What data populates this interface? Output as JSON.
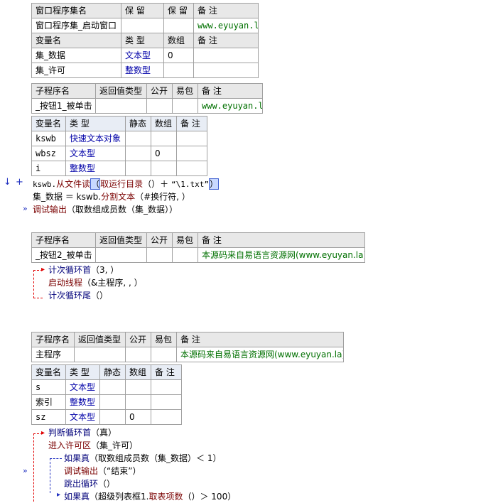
{
  "window_table": {
    "headers": [
      "窗口程序集名",
      "保 留",
      "保 留",
      "备 注"
    ],
    "row": [
      "窗口程序集_启动窗口",
      "",
      "",
      "www.eyuyan.la"
    ],
    "var_headers": [
      "变量名",
      "类 型",
      "数组",
      "备 注"
    ],
    "vars": [
      {
        "name": "集_数据",
        "type": "文本型",
        "array": "0",
        "note": ""
      },
      {
        "name": "集_许可",
        "type": "整数型",
        "array": "",
        "note": ""
      }
    ]
  },
  "sub1": {
    "headers": [
      "子程序名",
      "返回值类型",
      "公开",
      "易包",
      "备 注"
    ],
    "row": [
      "_按钮1_被单击",
      "",
      "",
      "",
      "www.eyuyan.la"
    ],
    "var_headers": [
      "变量名",
      "类 型",
      "静态",
      "数组",
      "备 注"
    ],
    "vars": [
      {
        "name": "kswb",
        "type": "快速文本对象",
        "static": "",
        "array": "",
        "note": ""
      },
      {
        "name": "wbsz",
        "type": "文本型",
        "static": "",
        "array": "0",
        "note": ""
      },
      {
        "name": "i",
        "type": "整数型",
        "static": "",
        "array": "",
        "note": ""
      }
    ],
    "code": {
      "line1_obj": "kswb.",
      "line1_method": "从文件读",
      "line1_arg_fn": "取运行目录",
      "line1_arg_rest": "（）＋",
      "line1_str": "“\\1.txt”",
      "line2": "集_数据 ＝ kswb.",
      "line2_method": "分割文本",
      "line2_rest": "（#换行符, ）",
      "line3_fn": "调试输出",
      "line3_rest": "（取数组成员数（集_数据））"
    }
  },
  "sub2": {
    "headers": [
      "子程序名",
      "返回值类型",
      "公开",
      "易包",
      "备 注"
    ],
    "row": [
      "_按钮2_被单击",
      "",
      "",
      "",
      "本源码来自易语言资源网(www.eyuyan.la)"
    ],
    "code": {
      "l1_fn": "计次循环首",
      "l1_rest": "（3, ）",
      "l2_fn": "启动线程",
      "l2_rest": "（&主程序, , ）",
      "l3_fn": "计次循环尾",
      "l3_rest": "（）"
    }
  },
  "sub3": {
    "headers": [
      "子程序名",
      "返回值类型",
      "公开",
      "易包",
      "备 注"
    ],
    "row": [
      "主程序",
      "",
      "",
      "",
      "本源码来自易语言资源网(www.eyuyan.la)"
    ],
    "var_headers": [
      "变量名",
      "类 型",
      "静态",
      "数组",
      "备 注"
    ],
    "vars": [
      {
        "name": "s",
        "type": "文本型",
        "static": "",
        "array": "",
        "note": ""
      },
      {
        "name": "索引",
        "type": "整数型",
        "static": "",
        "array": "",
        "note": ""
      },
      {
        "name": "sz",
        "type": "文本型",
        "static": "",
        "array": "0",
        "note": ""
      }
    ],
    "code": {
      "l1_fn": "判断循环首",
      "l1_rest": "（真）",
      "l2_fn": "进入许可区",
      "l2_rest": "（集_许可）",
      "l3_fn": "如果真",
      "l3_rest": "（取数组成员数（集_数据）＜ 1）",
      "l4_fn": "调试输出",
      "l4_rest": "（",
      "l4_str": "“结束”",
      "l4_end": "）",
      "l5_fn": "跳出循环",
      "l5_rest": "（）",
      "l6_fn": "如果真",
      "l6_rest": "（超级列表框1.",
      "l6_method": "取表项数",
      "l6_end": "（）＞ 100）"
    }
  },
  "markers": {
    "down_arrow": "↓",
    "plus": "+",
    "breakpoint": "»"
  }
}
